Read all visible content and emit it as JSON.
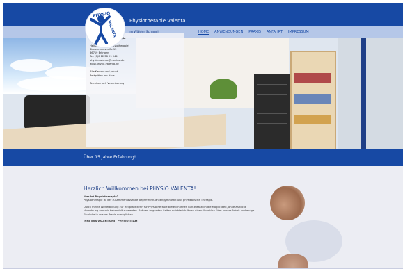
{
  "header": {
    "site_title": "Physiotherapie Valenta",
    "subtitle": "Im Wälder Schauch",
    "logo_text_top": "PHYSIO",
    "logo_text_side": "VALENTA"
  },
  "nav": {
    "items": [
      {
        "label": "HOME",
        "active": true
      },
      {
        "label": "ANWENDUNGEN",
        "active": false
      },
      {
        "label": "PRAXIS",
        "active": false
      },
      {
        "label": "ANFAHRT",
        "active": false
      },
      {
        "label": "IMPRESSUM",
        "active": false
      }
    ]
  },
  "infobox": {
    "lines": [
      "Praxis für Physiotherapie",
      "Eva Valenta",
      "Heilpraktikerin (Physiotherapie)",
      "Sindelmannstraße 13",
      "86719 Erlingen",
      "Tel. (0)0 12 38 29 044",
      "physio-valenta@t-online.de",
      "www.physio-valenta.de"
    ],
    "note_lines": [
      "Alle Kassen und privat",
      "Parkplätze am Haus"
    ],
    "footer_line": "Termine nach Vereinbarung"
  },
  "banner": {
    "text": "Über 15 Jahre Erfahrung!"
  },
  "main": {
    "welcome_title": "Herzlich Willkommen bei PHYSIO VALENTA!",
    "question": "Was ist Physiotherapie?",
    "paragraph1": "Physiotherapie ist der zusammenfassende Begriff für Krankengymnastik und physikalische Therapie.",
    "paragraph2": "Durch meine Weiterbildung zur Heilpraktikerin für Physiotherapie biete ich Ihnen nun zusätzlich die Möglichkeit, ohne ärztliche Verordnung von mir behandelt zu werden. Auf den folgenden Seiten möchte ich Ihnen einen Überblick über unsere Arbeit und einige Einblicke in unsere Praxis ermöglichen.",
    "signature": "IHRE EVA VALENTA MIT PHYSIO TEAM"
  },
  "colors": {
    "brand_blue": "#1749a4",
    "nav_bg": "#b5c7e8",
    "page_bg": "#ecedf3"
  }
}
